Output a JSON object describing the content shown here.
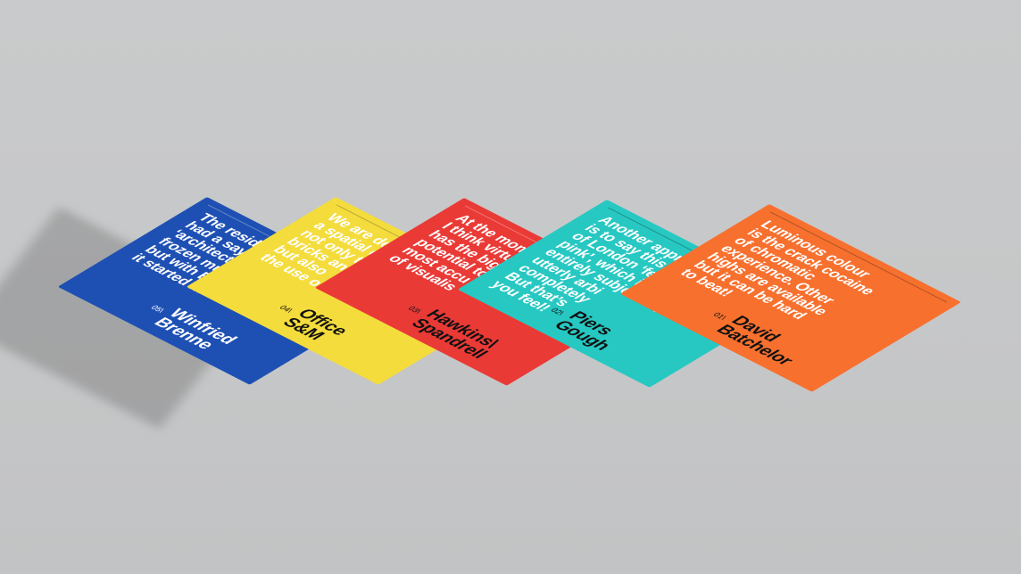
{
  "booklets": [
    {
      "number": "05\\",
      "name": "Winfried\nBrenne",
      "quote": "The residents\nhad a saying that\n‘architecture is\nfrozen music’\nbut with B\nit started m",
      "color": "#1e50b4",
      "text_color": "#ffffff",
      "name_color": "#ffffff"
    },
    {
      "number": "04\\",
      "name": "Office\nS&M",
      "quote": "We are designing\na spatial experience,\nnot only through\nbricks and\nbut also\nthe use o",
      "color": "#f4dc3c",
      "text_color": "#ffffff",
      "name_color": "#111111"
    },
    {
      "number": "03\\",
      "name": "Hawkins\\\nSpandrell",
      "quote": "At the moment,\nI think virtual reality\nhas the biggest\npotential to be the\nmost accu\nof visualis",
      "color": "#ea3a36",
      "text_color": "#ffffff",
      "name_color": "#111111"
    },
    {
      "number": "02\\",
      "name": "Piers\nGough",
      "quote": "Another approach\nis to say this area\nof London ‘feels\npink’, which is\nentirely subjective,\nutterly arbi\ncompletely\nBut that’s\nyou feel!",
      "color": "#27c8c2",
      "text_color": "#ffffff",
      "name_color": "#111111"
    },
    {
      "number": "01\\",
      "name": "David\nBatchelor",
      "quote": "Luminous colour\nis the crack cocaine\nof chromatic\nexperience. Other\nhighs are available\nbut it can be hard\nto beat!",
      "color": "#f7702e",
      "text_color": "#ffffff",
      "name_color": "#111111"
    }
  ]
}
